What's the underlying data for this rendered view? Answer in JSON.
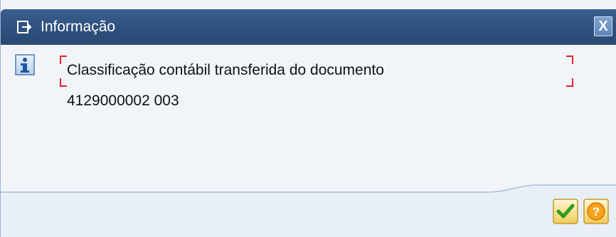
{
  "dialog": {
    "title": "Informação",
    "close_label": "X",
    "message_line1": "Classificação contábil transferida do documento",
    "message_line2": "4129000002 003"
  },
  "icons": {
    "title": "window-icon",
    "message": "info-icon",
    "ok": "checkmark-icon",
    "help": "help-icon"
  },
  "colors": {
    "titlebar": "#2e4f7c",
    "body": "#f1f5fa",
    "focus_frame": "#e0242b"
  }
}
